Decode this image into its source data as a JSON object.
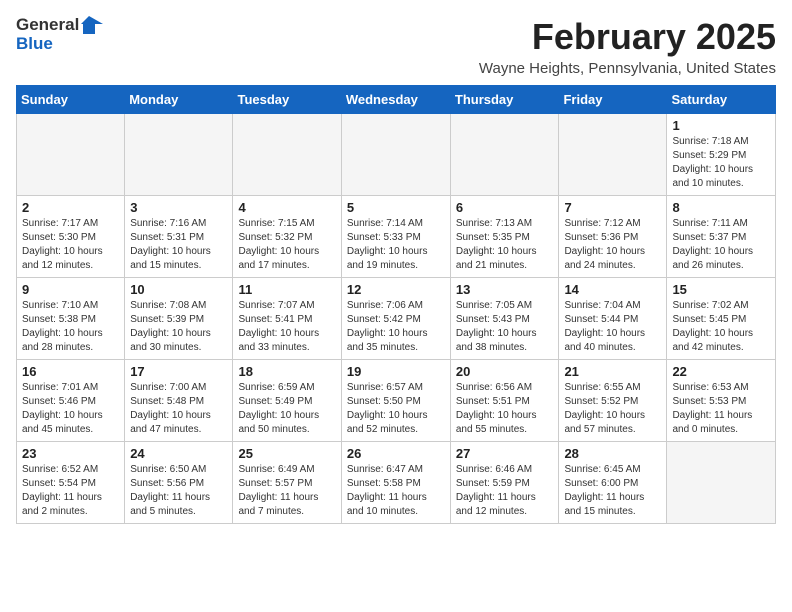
{
  "logo": {
    "general": "General",
    "blue": "Blue"
  },
  "title": "February 2025",
  "location": "Wayne Heights, Pennsylvania, United States",
  "weekdays": [
    "Sunday",
    "Monday",
    "Tuesday",
    "Wednesday",
    "Thursday",
    "Friday",
    "Saturday"
  ],
  "weeks": [
    [
      {
        "day": "",
        "info": ""
      },
      {
        "day": "",
        "info": ""
      },
      {
        "day": "",
        "info": ""
      },
      {
        "day": "",
        "info": ""
      },
      {
        "day": "",
        "info": ""
      },
      {
        "day": "",
        "info": ""
      },
      {
        "day": "1",
        "info": "Sunrise: 7:18 AM\nSunset: 5:29 PM\nDaylight: 10 hours\nand 10 minutes."
      }
    ],
    [
      {
        "day": "2",
        "info": "Sunrise: 7:17 AM\nSunset: 5:30 PM\nDaylight: 10 hours\nand 12 minutes."
      },
      {
        "day": "3",
        "info": "Sunrise: 7:16 AM\nSunset: 5:31 PM\nDaylight: 10 hours\nand 15 minutes."
      },
      {
        "day": "4",
        "info": "Sunrise: 7:15 AM\nSunset: 5:32 PM\nDaylight: 10 hours\nand 17 minutes."
      },
      {
        "day": "5",
        "info": "Sunrise: 7:14 AM\nSunset: 5:33 PM\nDaylight: 10 hours\nand 19 minutes."
      },
      {
        "day": "6",
        "info": "Sunrise: 7:13 AM\nSunset: 5:35 PM\nDaylight: 10 hours\nand 21 minutes."
      },
      {
        "day": "7",
        "info": "Sunrise: 7:12 AM\nSunset: 5:36 PM\nDaylight: 10 hours\nand 24 minutes."
      },
      {
        "day": "8",
        "info": "Sunrise: 7:11 AM\nSunset: 5:37 PM\nDaylight: 10 hours\nand 26 minutes."
      }
    ],
    [
      {
        "day": "9",
        "info": "Sunrise: 7:10 AM\nSunset: 5:38 PM\nDaylight: 10 hours\nand 28 minutes."
      },
      {
        "day": "10",
        "info": "Sunrise: 7:08 AM\nSunset: 5:39 PM\nDaylight: 10 hours\nand 30 minutes."
      },
      {
        "day": "11",
        "info": "Sunrise: 7:07 AM\nSunset: 5:41 PM\nDaylight: 10 hours\nand 33 minutes."
      },
      {
        "day": "12",
        "info": "Sunrise: 7:06 AM\nSunset: 5:42 PM\nDaylight: 10 hours\nand 35 minutes."
      },
      {
        "day": "13",
        "info": "Sunrise: 7:05 AM\nSunset: 5:43 PM\nDaylight: 10 hours\nand 38 minutes."
      },
      {
        "day": "14",
        "info": "Sunrise: 7:04 AM\nSunset: 5:44 PM\nDaylight: 10 hours\nand 40 minutes."
      },
      {
        "day": "15",
        "info": "Sunrise: 7:02 AM\nSunset: 5:45 PM\nDaylight: 10 hours\nand 42 minutes."
      }
    ],
    [
      {
        "day": "16",
        "info": "Sunrise: 7:01 AM\nSunset: 5:46 PM\nDaylight: 10 hours\nand 45 minutes."
      },
      {
        "day": "17",
        "info": "Sunrise: 7:00 AM\nSunset: 5:48 PM\nDaylight: 10 hours\nand 47 minutes."
      },
      {
        "day": "18",
        "info": "Sunrise: 6:59 AM\nSunset: 5:49 PM\nDaylight: 10 hours\nand 50 minutes."
      },
      {
        "day": "19",
        "info": "Sunrise: 6:57 AM\nSunset: 5:50 PM\nDaylight: 10 hours\nand 52 minutes."
      },
      {
        "day": "20",
        "info": "Sunrise: 6:56 AM\nSunset: 5:51 PM\nDaylight: 10 hours\nand 55 minutes."
      },
      {
        "day": "21",
        "info": "Sunrise: 6:55 AM\nSunset: 5:52 PM\nDaylight: 10 hours\nand 57 minutes."
      },
      {
        "day": "22",
        "info": "Sunrise: 6:53 AM\nSunset: 5:53 PM\nDaylight: 11 hours\nand 0 minutes."
      }
    ],
    [
      {
        "day": "23",
        "info": "Sunrise: 6:52 AM\nSunset: 5:54 PM\nDaylight: 11 hours\nand 2 minutes."
      },
      {
        "day": "24",
        "info": "Sunrise: 6:50 AM\nSunset: 5:56 PM\nDaylight: 11 hours\nand 5 minutes."
      },
      {
        "day": "25",
        "info": "Sunrise: 6:49 AM\nSunset: 5:57 PM\nDaylight: 11 hours\nand 7 minutes."
      },
      {
        "day": "26",
        "info": "Sunrise: 6:47 AM\nSunset: 5:58 PM\nDaylight: 11 hours\nand 10 minutes."
      },
      {
        "day": "27",
        "info": "Sunrise: 6:46 AM\nSunset: 5:59 PM\nDaylight: 11 hours\nand 12 minutes."
      },
      {
        "day": "28",
        "info": "Sunrise: 6:45 AM\nSunset: 6:00 PM\nDaylight: 11 hours\nand 15 minutes."
      },
      {
        "day": "",
        "info": ""
      }
    ]
  ]
}
